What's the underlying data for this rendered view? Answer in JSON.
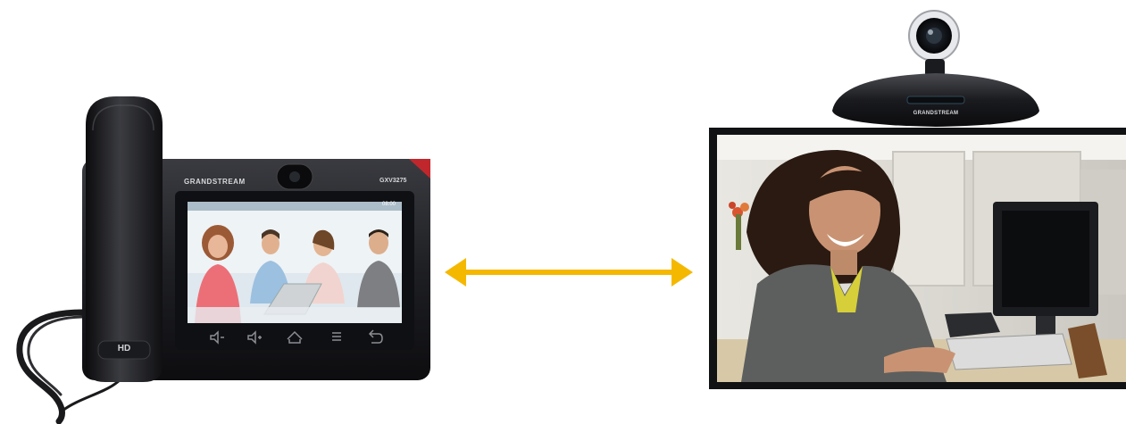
{
  "phone": {
    "brand": "GRANDSTREAM",
    "model": "GXV3275",
    "handset_badge": "HD",
    "status_time": "08:00"
  },
  "camera": {
    "brand": "GRANDSTREAM"
  },
  "colors": {
    "arrow": "#f5b800",
    "device_body": "#1c1d21",
    "bezel": "#2a2b30"
  }
}
